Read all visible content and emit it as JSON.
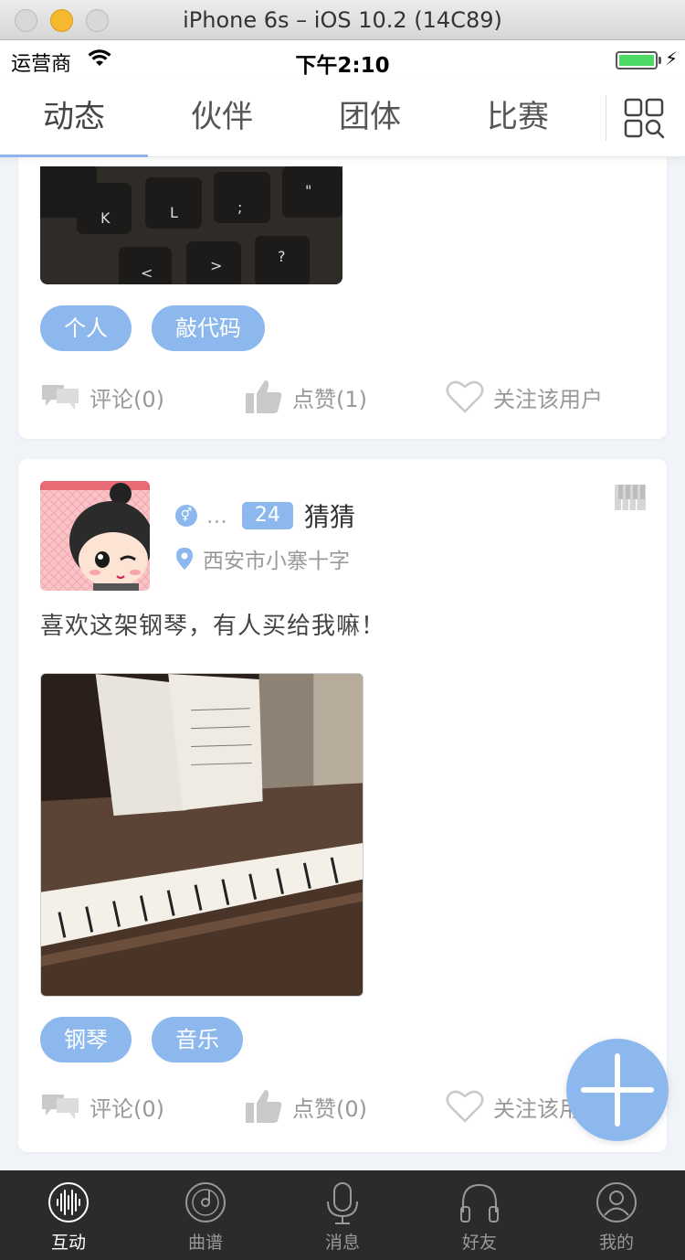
{
  "window": {
    "title": "iPhone 6s – iOS 10.2 (14C89)"
  },
  "status_bar": {
    "carrier": "运营商",
    "time": "下午2:10"
  },
  "top_tabs": [
    {
      "label": "动态",
      "active": true
    },
    {
      "label": "伙伴",
      "active": false
    },
    {
      "label": "团体",
      "active": false
    },
    {
      "label": "比赛",
      "active": false
    }
  ],
  "posts": [
    {
      "image_icon": "keyboard-photo",
      "tags": [
        "个人",
        "敲代码"
      ],
      "actions": {
        "comment": "评论(0)",
        "like": "点赞(1)",
        "follow": "关注该用户"
      }
    },
    {
      "gender_icon": "gender-icon",
      "name_ellipsis": "...",
      "age": "24",
      "username": "猜猜",
      "location": "西安市小寨十字",
      "text": "喜欢这架钢琴，有人买给我嘛！",
      "image_icon": "piano-photo",
      "tags": [
        "钢琴",
        "音乐"
      ],
      "actions": {
        "comment": "评论(0)",
        "like": "点赞(0)",
        "follow": "关注该用户"
      }
    }
  ],
  "bottom_tabs": [
    {
      "label": "互动",
      "icon": "soundwave-icon",
      "active": true
    },
    {
      "label": "曲谱",
      "icon": "disc-icon",
      "active": false
    },
    {
      "label": "消息",
      "icon": "microphone-icon",
      "active": false
    },
    {
      "label": "好友",
      "icon": "headphones-icon",
      "active": false
    },
    {
      "label": "我的",
      "icon": "user-icon",
      "active": false
    }
  ],
  "colors": {
    "accent": "#8db8ee",
    "tab_bar": "#2b2b2b",
    "background": "#f0f3f7"
  }
}
